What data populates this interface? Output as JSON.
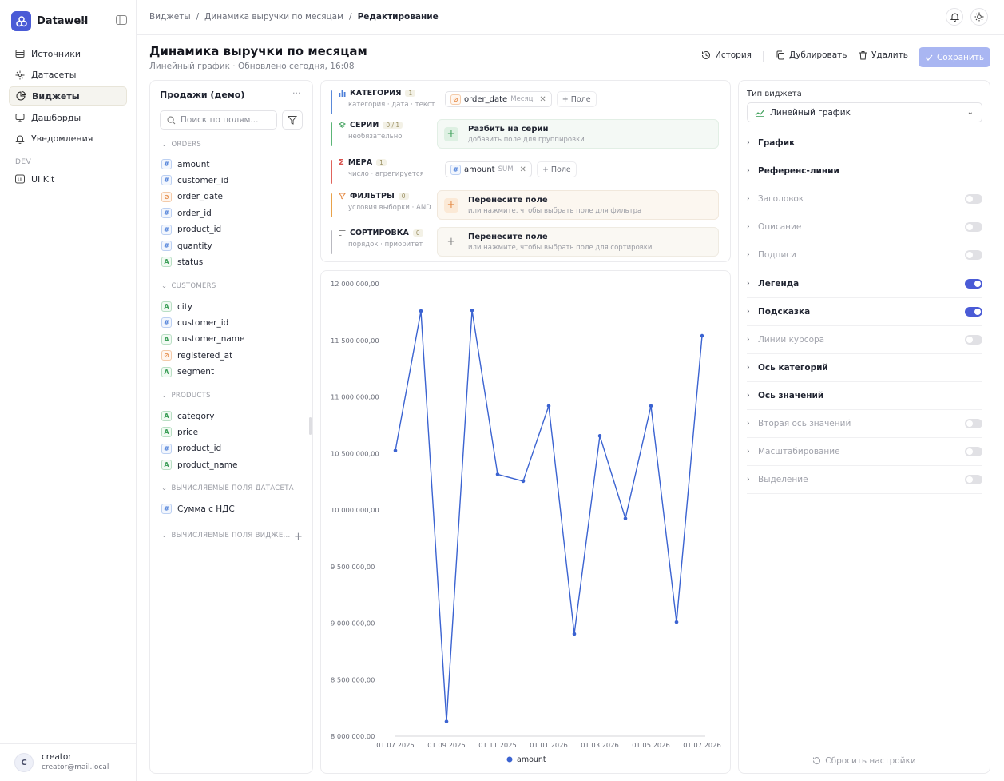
{
  "app": {
    "name": "Datawell"
  },
  "nav": [
    {
      "label": "Источники",
      "icon": "database-icon",
      "name": "sources"
    },
    {
      "label": "Датасеты",
      "icon": "dataset-icon",
      "name": "datasets"
    },
    {
      "label": "Виджеты",
      "icon": "widget-icon",
      "name": "widgets",
      "active": true
    },
    {
      "label": "Дашборды",
      "icon": "dashboard-icon",
      "name": "dashboards"
    },
    {
      "label": "Уведомления",
      "icon": "bell-icon",
      "name": "notifications"
    }
  ],
  "dev": {
    "label": "DEV",
    "item": "UI Kit"
  },
  "user": {
    "initial": "C",
    "name": "creator",
    "email": "creator@mail.local"
  },
  "breadcrumbs": [
    "Виджеты",
    "Динамика выручки по месяцам",
    "Редактирование"
  ],
  "header": {
    "title": "Динамика выручки по месяцам",
    "chart_kind": "Линейный график",
    "updated": "Обновлено сегодня, 16:08",
    "history": "История",
    "duplicate": "Дублировать",
    "delete": "Удалить",
    "save": "Сохранить"
  },
  "fields": {
    "dataset": "Продажи (демо)",
    "search_placeholder": "Поиск по полям...",
    "groups": [
      {
        "name": "ORDERS",
        "items": [
          [
            "#",
            "amount"
          ],
          [
            "#",
            "customer_id"
          ],
          [
            "d",
            "order_date"
          ],
          [
            "#",
            "order_id"
          ],
          [
            "#",
            "product_id"
          ],
          [
            "#",
            "quantity"
          ],
          [
            "A",
            "status"
          ]
        ]
      },
      {
        "name": "CUSTOMERS",
        "items": [
          [
            "A",
            "city"
          ],
          [
            "#",
            "customer_id"
          ],
          [
            "A",
            "customer_name"
          ],
          [
            "d",
            "registered_at"
          ],
          [
            "A",
            "segment"
          ]
        ]
      },
      {
        "name": "PRODUCTS",
        "items": [
          [
            "A",
            "category"
          ],
          [
            "A",
            "price"
          ],
          [
            "#",
            "product_id"
          ],
          [
            "A",
            "product_name"
          ]
        ]
      },
      {
        "name": "ВЫЧИСЛЯЕМЫЕ ПОЛЯ ДАТАСЕТА",
        "items": [
          [
            "#",
            "Сумма с НДС"
          ]
        ]
      },
      {
        "name": "ВЫЧИСЛЯЕМЫЕ ПОЛЯ ВИДЖЕ...",
        "items": []
      }
    ]
  },
  "shelves": {
    "category": {
      "label": "КАТЕГОРИЯ",
      "count": "1",
      "desc": "категория · дата · текст",
      "chip": "order_date",
      "chip_agg": "Месяц",
      "add": "Поле"
    },
    "series": {
      "label": "СЕРИИ",
      "count": "0 / 1",
      "desc": "необязательно",
      "t1": "Разбить на серии",
      "t2": "добавить поле для группировки"
    },
    "measure": {
      "label": "МЕРА",
      "count": "1",
      "desc": "число · агрегируется",
      "chip": "amount",
      "chip_agg": "SUM",
      "add": "Поле"
    },
    "filters": {
      "label": "ФИЛЬТРЫ",
      "count": "0",
      "desc": "условия выборки · AND",
      "t1": "Перенесите поле",
      "t2": "или нажмите, чтобы выбрать поле для фильтра"
    },
    "sort": {
      "label": "СОРТИРОВКА",
      "count": "0",
      "desc": "порядок · приоритет",
      "t1": "Перенесите поле",
      "t2": "или нажмите, чтобы выбрать поле для сортировки"
    }
  },
  "colors": {
    "accent": "#4a5bd6",
    "line": "#3b63d1"
  },
  "chart_data": {
    "type": "line",
    "x": [
      "01.07.2025",
      "01.08.2025",
      "01.09.2025",
      "01.10.2025",
      "01.11.2025",
      "01.12.2025",
      "01.01.2026",
      "01.02.2026",
      "01.03.2026",
      "01.04.2026",
      "01.05.2026",
      "01.06.2026",
      "01.07.2026"
    ],
    "x_ticks": [
      "01.07.2025",
      "01.09.2025",
      "01.11.2025",
      "01.01.2026",
      "01.03.2026",
      "01.05.2026",
      "01.07.2026"
    ],
    "y_ticks": [
      "8 000 000,00",
      "8 500 000,00",
      "9 000 000,00",
      "9 500 000,00",
      "10 000 000,00",
      "10 500 000,00",
      "11 000 000,00",
      "11 500 000,00",
      "12 000 000,00"
    ],
    "ylim": [
      8000000,
      12000000
    ],
    "series": [
      {
        "name": "amount",
        "values": [
          10525000,
          11760000,
          8130000,
          11765000,
          10315000,
          10255000,
          10920000,
          8905000,
          10655000,
          9925000,
          10920000,
          9010000,
          11540000
        ]
      }
    ],
    "legend": "bottom"
  },
  "settings": {
    "type_label": "Тип виджета",
    "type_value": "Линейный график",
    "rows": [
      {
        "label": "График",
        "state": "none"
      },
      {
        "label": "Референс-линии",
        "state": "none"
      },
      {
        "label": "Заголовок",
        "state": "off"
      },
      {
        "label": "Описание",
        "state": "off"
      },
      {
        "label": "Подписи",
        "state": "off"
      },
      {
        "label": "Легенда",
        "state": "on"
      },
      {
        "label": "Подсказка",
        "state": "on"
      },
      {
        "label": "Линии курсора",
        "state": "off"
      },
      {
        "label": "Ось категорий",
        "state": "none"
      },
      {
        "label": "Ось значений",
        "state": "none"
      },
      {
        "label": "Вторая ось значений",
        "state": "off"
      },
      {
        "label": "Масштабирование",
        "state": "off"
      },
      {
        "label": "Выделение",
        "state": "off"
      }
    ],
    "reset": "Сбросить настройки"
  }
}
